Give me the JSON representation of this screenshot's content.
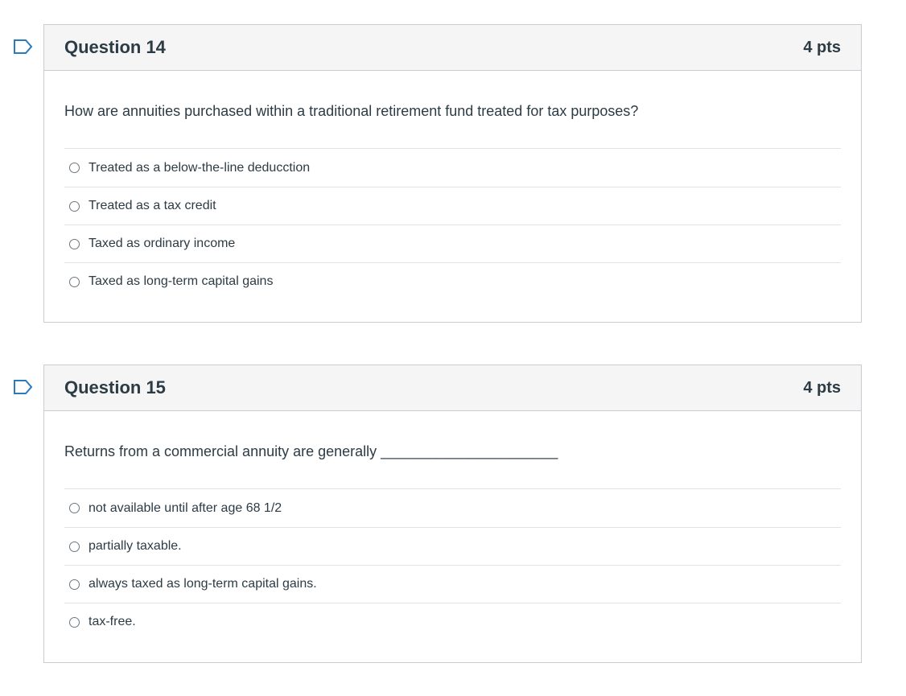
{
  "questions": [
    {
      "title": "Question 14",
      "points": "4 pts",
      "text": "How are annuities purchased within a traditional retirement fund treated for tax purposes?",
      "answers": [
        "Treated as a below-the-line deducction",
        "Treated as a tax credit",
        "Taxed as ordinary income",
        "Taxed as long-term capital gains"
      ]
    },
    {
      "title": "Question 15",
      "points": "4 pts",
      "text": "Returns from a commercial annuity are generally ______________________",
      "answers": [
        "not available until after age 68 1/2",
        "partially taxable.",
        "always taxed as long-term capital gains.",
        "tax-free."
      ]
    }
  ],
  "colors": {
    "flag": "#2b7abc",
    "header_bg": "#f5f5f5",
    "border": "#c7cdd1",
    "text": "#2d3b45"
  }
}
